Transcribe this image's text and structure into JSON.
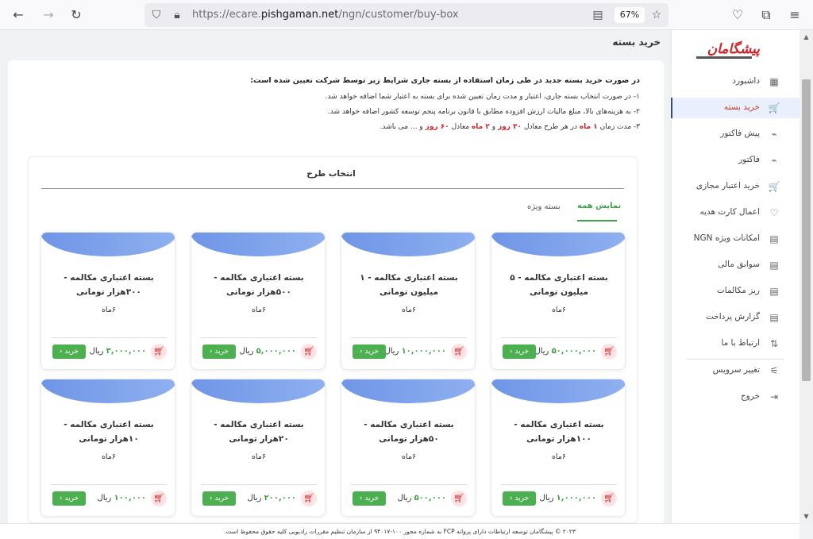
{
  "browser": {
    "url_prefix": "https://ecare.",
    "url_domain": "pishgaman.net",
    "url_path": "/ngn/customer/buy-box",
    "zoom": "67%"
  },
  "sidebar": {
    "logo": "پیشگامان",
    "items": [
      {
        "label": "داشبورد",
        "icon": "▦"
      },
      {
        "label": "خرید بسته",
        "icon": "🛒"
      },
      {
        "label": "پیش فاکتور",
        "icon": "⌁"
      },
      {
        "label": "فاکتور",
        "icon": "⌁"
      },
      {
        "label": "خرید اعتبار مجازی",
        "icon": "🛒"
      },
      {
        "label": "اعمال کارت هدیه",
        "icon": "♡"
      },
      {
        "label": "امکانات ویژه NGN",
        "icon": "▤"
      },
      {
        "label": "سوابق مالی",
        "icon": "▤"
      },
      {
        "label": "ریز مکالمات",
        "icon": "▤"
      },
      {
        "label": "گزارش پرداخت",
        "icon": "▤"
      },
      {
        "label": "ارتباط با ما",
        "icon": "⇅"
      },
      {
        "label": "تغییر سرویس",
        "icon": "⚟"
      },
      {
        "label": "خروج",
        "icon": "⇥"
      }
    ]
  },
  "page": {
    "title": "خرید بسته",
    "notice_heading": "در صورت خرید بسته جدید در طی زمان استفاده از بسته جاری شرایط زیر توسط شرکت تعیین شده است:",
    "notice_1": "۱- در صورت انتخاب بسته جاری، اعتبار و مدت زمان تعیین شده برای بسته به اعتبار شما اضافه خواهد شد.",
    "notice_2": "۲- به هزینه‌های بالا، مبلغ مالیات ارزش افزوده مطابق با قانون برنامه پنجم توسعه کشور اضافه خواهد شد.",
    "notice_3_a": "۳- مدت زمان",
    "notice_3_b": "۱ ماه",
    "notice_3_c": "در هر طرح معادل",
    "notice_3_d": "۳۰ روز",
    "notice_3_e": "و",
    "notice_3_f": "۲ ماه",
    "notice_3_g": "معادل",
    "notice_3_h": "۶۰ روز",
    "notice_3_i": "و ... می باشد.",
    "plan_title": "انتخاب طرح",
    "tab_all": "نمایش همه",
    "tab_special": "بسته ویژه"
  },
  "cards": [
    {
      "title": "بسته اعتباری مکالمه - ۵ میلیون تومانی",
      "duration": "۶ماه",
      "price": "۵۰,۰۰۰,۰۰۰",
      "currency": "ریال",
      "buy": "خرید"
    },
    {
      "title": "بسته اعتباری مکالمه - ۱ میلیون تومانی",
      "duration": "۶ماه",
      "price": "۱۰,۰۰۰,۰۰۰",
      "currency": "ریال",
      "buy": "خرید"
    },
    {
      "title": "بسته اعتباری مکالمه - ۵۰۰هزار تومانی",
      "duration": "۶ماه",
      "price": "۵,۰۰۰,۰۰۰",
      "currency": "ریال",
      "buy": "خرید"
    },
    {
      "title": "بسته اعتباری مکالمه - ۳۰۰هزار تومانی",
      "duration": "۶ماه",
      "price": "۳,۰۰۰,۰۰۰",
      "currency": "ریال",
      "buy": "خرید"
    },
    {
      "title": "بسته اعتباری مکالمه - ۱۰۰هزار تومانی",
      "duration": "۶ماه",
      "price": "۱,۰۰۰,۰۰۰",
      "currency": "ریال",
      "buy": "خرید"
    },
    {
      "title": "بسته اعتباری مکالمه - ۵۰هزار تومانی",
      "duration": "۶ماه",
      "price": "۵۰۰,۰۰۰",
      "currency": "ریال",
      "buy": "خرید"
    },
    {
      "title": "بسته اعتباری مکالمه - ۲۰هزار تومانی",
      "duration": "۶ماه",
      "price": "۲۰۰,۰۰۰",
      "currency": "ریال",
      "buy": "خرید"
    },
    {
      "title": "بسته اعتباری مکالمه - ۱۰هزار تومانی",
      "duration": "۶ماه",
      "price": "۱۰۰,۰۰۰",
      "currency": "ریال",
      "buy": "خرید"
    }
  ],
  "footer": "۲۰۲۳ © پیشگامان توسعه ارتباطات دارای پروانه FCP به شماره مجوز ۱۰۰-۹۴۰۱۷ از سازمان تنظیم مقررات رادیویی کلیه حقوق محفوظ است."
}
